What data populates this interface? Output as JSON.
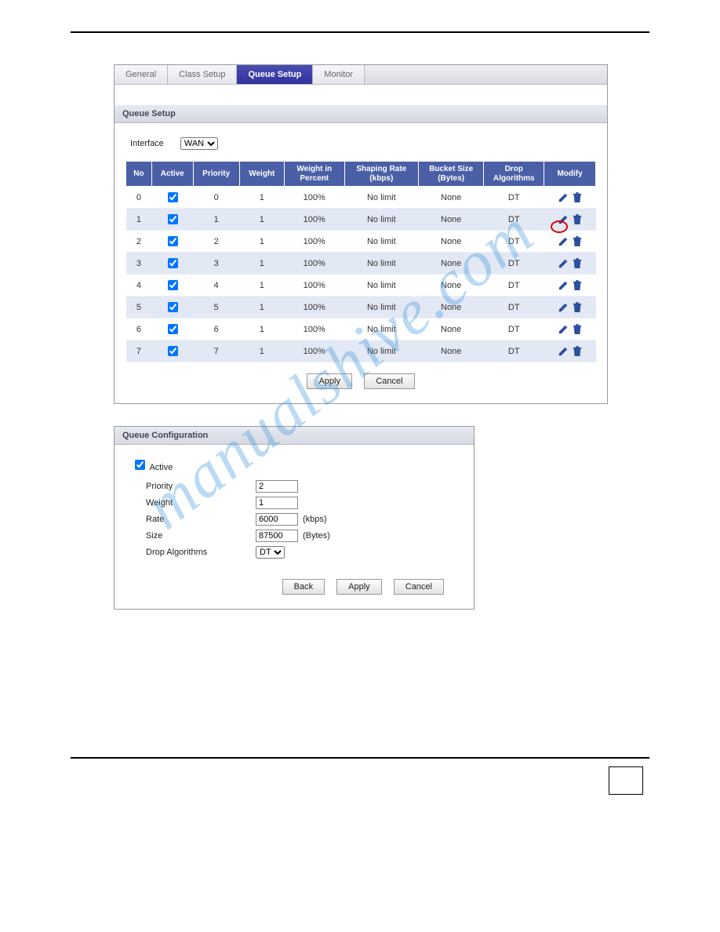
{
  "tabs": {
    "general": "General",
    "class": "Class Setup",
    "queue": "Queue Setup",
    "monitor": "Monitor"
  },
  "queue_setup": {
    "title": "Queue Setup",
    "interface_label": "Interface",
    "interface_value": "WAN",
    "headers": {
      "no": "No",
      "active": "Active",
      "priority": "Priority",
      "weight": "Weight",
      "wpct": "Weight in Percent",
      "rate": "Shaping Rate (kbps)",
      "bucket": "Bucket Size (Bytes)",
      "drop": "Drop Algorithms",
      "modify": "Modify"
    },
    "rows": [
      {
        "no": "0",
        "active": true,
        "priority": "0",
        "weight": "1",
        "wpct": "100%",
        "rate": "No limit",
        "bucket": "None",
        "drop": "DT"
      },
      {
        "no": "1",
        "active": true,
        "priority": "1",
        "weight": "1",
        "wpct": "100%",
        "rate": "No limit",
        "bucket": "None",
        "drop": "DT"
      },
      {
        "no": "2",
        "active": true,
        "priority": "2",
        "weight": "1",
        "wpct": "100%",
        "rate": "No limit",
        "bucket": "None",
        "drop": "DT"
      },
      {
        "no": "3",
        "active": true,
        "priority": "3",
        "weight": "1",
        "wpct": "100%",
        "rate": "No limit",
        "bucket": "None",
        "drop": "DT"
      },
      {
        "no": "4",
        "active": true,
        "priority": "4",
        "weight": "1",
        "wpct": "100%",
        "rate": "No limit",
        "bucket": "None",
        "drop": "DT"
      },
      {
        "no": "5",
        "active": true,
        "priority": "5",
        "weight": "1",
        "wpct": "100%",
        "rate": "No limit",
        "bucket": "None",
        "drop": "DT"
      },
      {
        "no": "6",
        "active": true,
        "priority": "6",
        "weight": "1",
        "wpct": "100%",
        "rate": "No limit",
        "bucket": "None",
        "drop": "DT"
      },
      {
        "no": "7",
        "active": true,
        "priority": "7",
        "weight": "1",
        "wpct": "100%",
        "rate": "No limit",
        "bucket": "None",
        "drop": "DT"
      }
    ],
    "apply": "Apply",
    "cancel": "Cancel"
  },
  "queue_conf": {
    "title": "Queue Configuration",
    "active_label": "Active",
    "active_checked": true,
    "priority_label": "Priority",
    "priority_value": "2",
    "weight_label": "Weight",
    "weight_value": "1",
    "rate_label": "Rate",
    "rate_value": "6000",
    "rate_unit": "(kbps)",
    "size_label": "Size",
    "size_value": "87500",
    "size_unit": "(Bytes)",
    "drop_label": "Drop Algorithms",
    "drop_value": "DT",
    "back": "Back",
    "apply": "Apply",
    "cancel": "Cancel"
  },
  "watermark_text": "manualshive.com"
}
